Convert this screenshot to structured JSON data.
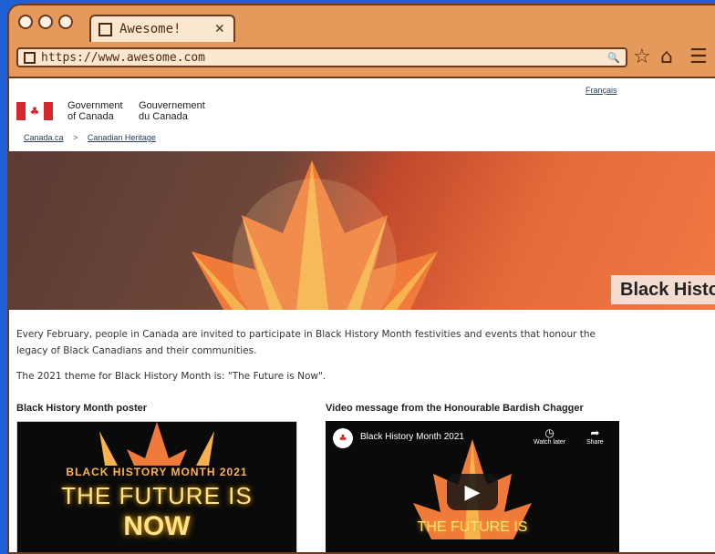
{
  "browser": {
    "tab_title": "Awesome!",
    "tab_close": "✕",
    "url": "https://www.awesome.com",
    "nav_icons": [
      "star-icon",
      "home-icon",
      "menu-icon"
    ]
  },
  "header": {
    "gov_en_line1": "Government",
    "gov_en_line2": "of Canada",
    "gov_fr_line1": "Gouvernement",
    "gov_fr_line2": "du Canada",
    "language_link": "Français"
  },
  "breadcrumb": {
    "item1": "Canada.ca",
    "separator": ">",
    "item2": "Canadian Heritage"
  },
  "banner": {
    "title": "Black Histo"
  },
  "main": {
    "intro_line1": "Every February, people in Canada are invited to participate in Black History Month festivities and events that honour the",
    "intro_line2": "legacy of Black Canadians and their communities.",
    "theme": "The 2021 theme for Black History Month is: \"The Future is Now\".",
    "poster_heading": "Black History Month poster",
    "video_heading": "Video message from the Honourable Bardish Chagger"
  },
  "poster": {
    "line1": "BLACK HISTORY MONTH 2021",
    "line2": "THE FUTURE IS",
    "line3": "NOW"
  },
  "video": {
    "title": "Black History Month 2021",
    "watch_later": "Watch later",
    "share": "Share",
    "overlay_text": "THE FUTURE IS"
  },
  "colors": {
    "frame": "#e59a5c",
    "page_bg": "#1f5fd6",
    "canada_red": "#d7262e"
  }
}
